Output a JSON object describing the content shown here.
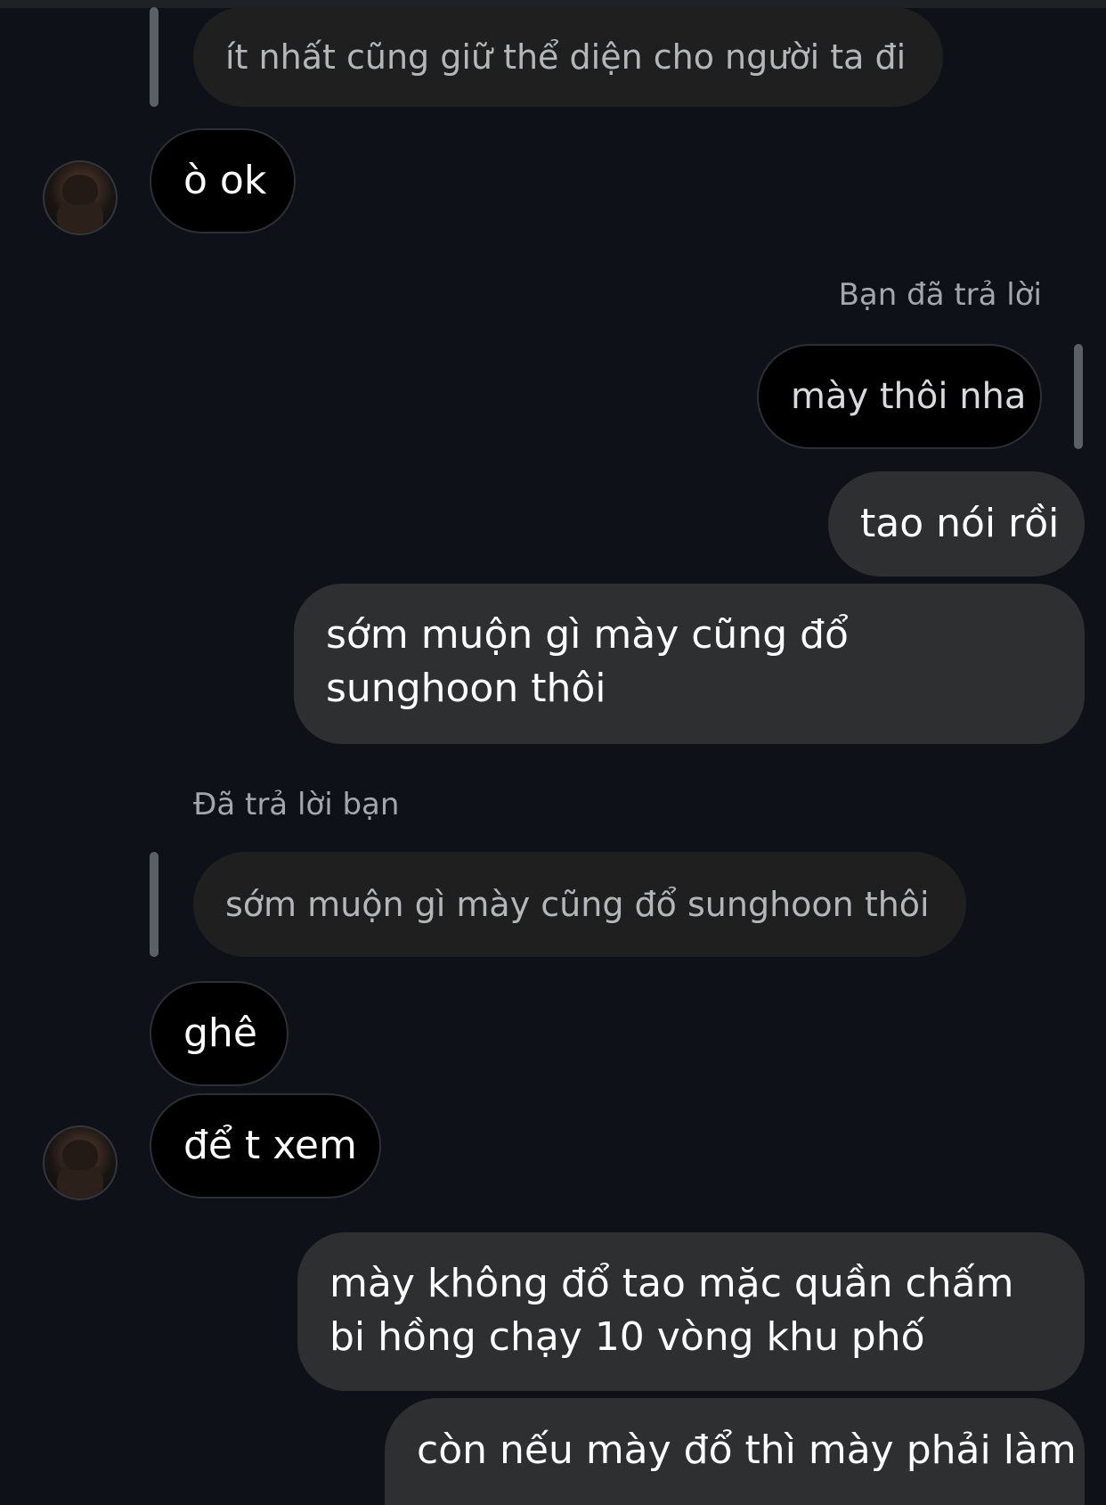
{
  "messages": {
    "m1_quoted": "ít nhất cũng giữ thể diện cho người ta đi",
    "m2_incoming": "ò ok",
    "m3_reply_label": "Bạn đã trả lời",
    "m4_quoted_self": "mày thôi nha",
    "m5_outgoing": "tao nói rồi",
    "m6_outgoing": "sớm muộn gì mày cũng đổ sunghoon thôi",
    "m7_reply_label": "Đã trả lời bạn",
    "m8_quoted": "sớm muộn gì mày cũng đổ sunghoon thôi",
    "m9_incoming": "ghê",
    "m10_incoming": "để t xem",
    "m11_outgoing": "mày không đổ tao mặc quần chấm bi hồng chạy 10 vòng khu phố",
    "m12_outgoing": "còn nếu mày đổ thì mày phải làm"
  },
  "icons": {
    "contact_avatar": "avatar-icon"
  },
  "colors": {
    "background": "#0e1117",
    "incoming_bubble": "#000000",
    "outgoing_bubble": "#2e2f31",
    "quoted_bubble": "#1f1f20",
    "reply_bar": "#5b5f66",
    "meta_text": "#a3a6ab"
  }
}
